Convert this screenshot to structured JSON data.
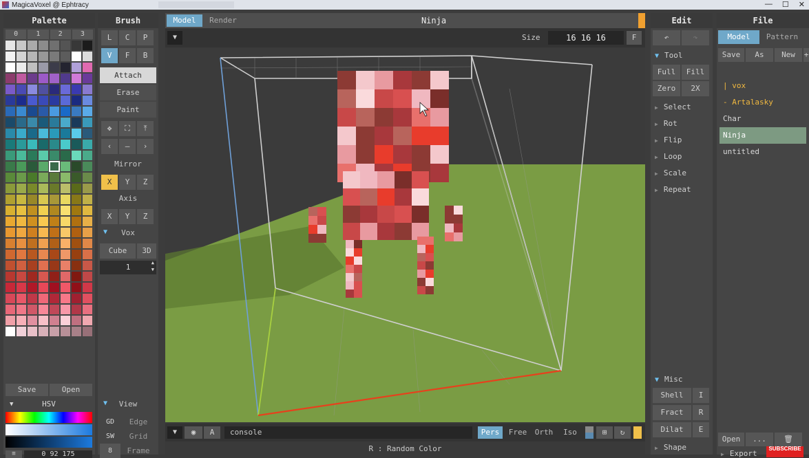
{
  "window": {
    "title": "MagicaVoxel @ Ephtracy",
    "controls": [
      "—",
      "☐",
      "✕"
    ]
  },
  "palette": {
    "title": "Palette",
    "tabs": [
      "0",
      "1",
      "2",
      "3"
    ],
    "save_label": "Save",
    "open_label": "Open",
    "hsv_label": "HSV",
    "hsv_values": "0 92 175",
    "menu_icon": "≡",
    "selected_index": 92,
    "colors": [
      "#e6e6e6",
      "#c8c8c8",
      "#aaaaaa",
      "#8c8c8c",
      "#707070",
      "#545454",
      "#383838",
      "#1c1c1c",
      "#f2f2f2",
      "#d4d4d4",
      "#b6b6b6",
      "#989898",
      "#7a7a7a",
      "#5c5c5c",
      "#ffffff",
      "#dcdcdc",
      "#ffffff",
      "#ececec",
      "#c0c0c0",
      "#9a9aa8",
      "#3c3c4a",
      "#242430",
      "#b0a0d8",
      "#e06ab0",
      "#8c3c6c",
      "#c05aa0",
      "#6c3c8c",
      "#9c5ac8",
      "#a062c8",
      "#503a8c",
      "#d07ad8",
      "#6a3a9a",
      "#7a5ac8",
      "#4a4ab4",
      "#8a8ae0",
      "#5050a0",
      "#2a2a7a",
      "#6a6ad8",
      "#3a3ab0",
      "#8a7ad0",
      "#2a3a9a",
      "#1c2c8c",
      "#4a5ad0",
      "#3a4ab8",
      "#2a3aa0",
      "#5a6ad8",
      "#1a2a80",
      "#6a8ae0",
      "#2a6ab8",
      "#3a8ad0",
      "#1a4a90",
      "#2a5aa8",
      "#4a9ae0",
      "#1a6ac8",
      "#3a7ac0",
      "#5aaae8",
      "#1a4a6a",
      "#2a6a8a",
      "#3a8aaa",
      "#1a5a7a",
      "#2a7a9a",
      "#4aaaca",
      "#1a3a5a",
      "#3a9aba",
      "#2a8aaa",
      "#3aaaca",
      "#1a6a8a",
      "#4abada",
      "#2a9aba",
      "#1a7a9a",
      "#5acaea",
      "#2a5a7a",
      "#1a7a7a",
      "#2a9a9a",
      "#3ababa",
      "#1a6a6a",
      "#2a8a8a",
      "#4acaca",
      "#1a5a5a",
      "#3aaaaa",
      "#3a9a7a",
      "#4aba9a",
      "#2a7a5a",
      "#5acaaa",
      "#3a8a6a",
      "#2a6a4a",
      "#6adaba",
      "#4aaa8a",
      "#3a7a4a",
      "#4a9a5a",
      "#2a5a3a",
      "#5aaa6a",
      "#3a6a4a",
      "#6aba7a",
      "#2a4a2a",
      "#4a8a5a",
      "#5a8a3a",
      "#6a9a4a",
      "#4a7a2a",
      "#7aaa5a",
      "#5a7a3a",
      "#8aba6a",
      "#3a5a2a",
      "#6a8a4a",
      "#8a9a3a",
      "#9aaa4a",
      "#7a8a2a",
      "#aaba5a",
      "#6a7a2a",
      "#babe6a",
      "#5a6a1a",
      "#9a9a4a",
      "#b0a030",
      "#c8b840",
      "#988828",
      "#d8c850",
      "#a89838",
      "#e8d860",
      "#887818",
      "#c0b048",
      "#d8b030",
      "#e8c040",
      "#c09020",
      "#f0d050",
      "#b08820",
      "#f8e070",
      "#a07810",
      "#e0b840",
      "#e8a830",
      "#f0b840",
      "#d09020",
      "#f8c850",
      "#c08018",
      "#f8d868",
      "#b07010",
      "#e8b048",
      "#e89830",
      "#f0a840",
      "#d08020",
      "#f8b850",
      "#c07018",
      "#f8c868",
      "#b06010",
      "#e8a048",
      "#d88030",
      "#e89040",
      "#c07020",
      "#f0a050",
      "#b06018",
      "#f8b068",
      "#a05010",
      "#e08848",
      "#d06830",
      "#e07840",
      "#b85820",
      "#e88850",
      "#a84818",
      "#f09868",
      "#984010",
      "#d87048",
      "#c05030",
      "#d06040",
      "#a84020",
      "#e07050",
      "#983818",
      "#e88068",
      "#883010",
      "#c85848",
      "#b83830",
      "#c84840",
      "#a02820",
      "#d85850",
      "#902018",
      "#e06868",
      "#801810",
      "#c04848",
      "#c82838",
      "#d83848",
      "#b01828",
      "#e84858",
      "#a01020",
      "#f05868",
      "#901018",
      "#d03848",
      "#d84858",
      "#e85868",
      "#c03848",
      "#f06878",
      "#b02838",
      "#f87888",
      "#a02030",
      "#e05060",
      "#e86878",
      "#f07888",
      "#d05868",
      "#f88898",
      "#c04858",
      "#f898a8",
      "#b03848",
      "#e87080",
      "#f0a0a8",
      "#f8b0b8",
      "#e090a0",
      "#f8c0c8",
      "#d08090",
      "#fcd0d8",
      "#c07080",
      "#f0a8b0",
      "#ffffff",
      "#f0d0d8",
      "#e8c0c8",
      "#d8b0b8",
      "#c8a0a8",
      "#b89098",
      "#a88088",
      "#987078"
    ]
  },
  "brush": {
    "title": "Brush",
    "row1": [
      "L",
      "C",
      "P"
    ],
    "row2": [
      "V",
      "F",
      "B"
    ],
    "modes": [
      "Attach",
      "Erase",
      "Paint"
    ],
    "tool_icons": [
      "move-icon",
      "select-box-icon",
      "pick-icon"
    ],
    "tool_glyphs": [
      "✥",
      "⛶",
      "⤒"
    ],
    "nav": [
      "‹",
      "—",
      "›"
    ],
    "mirror_label": "Mirror",
    "mirror": [
      "X",
      "Y",
      "Z"
    ],
    "axis_label": "Axis",
    "axis": [
      "X",
      "Y",
      "Z"
    ],
    "vox_label": "Vox",
    "vox_opts": [
      "Cube",
      "3D"
    ],
    "vox_value": "1",
    "view_label": "View",
    "view_rows": [
      {
        "key": "GD",
        "label": "Edge"
      },
      {
        "key": "SW",
        "label": "Grid"
      },
      {
        "key": "8",
        "label": "Frame"
      }
    ]
  },
  "viewport": {
    "tabs": [
      "Model",
      "Render"
    ],
    "title": "Ninja",
    "size_label": "Size",
    "size_value": "16 16 16",
    "f_label": "F",
    "console_placeholder": "console",
    "a_label": "A",
    "modes": [
      "Pers",
      "Free",
      "Orth",
      "Iso"
    ],
    "status": "R : Random Color",
    "floor_color": "#7a9c44",
    "bg_color": "#3b3b3b"
  },
  "edit": {
    "title": "Edit",
    "tool_label": "Tool",
    "tools": [
      [
        "Full",
        "Fill"
      ],
      [
        "Zero",
        "2X"
      ]
    ],
    "items": [
      "Select",
      "Rot",
      "Flip",
      "Loop",
      "Scale",
      "Repeat"
    ],
    "misc_label": "Misc",
    "misc": [
      [
        "Shell",
        "I"
      ],
      [
        "Fract",
        "R"
      ],
      [
        "Dilat",
        "E"
      ]
    ],
    "shape_label": "Shape"
  },
  "file": {
    "title": "File",
    "tabs": [
      "Model",
      "Pattern"
    ],
    "actions": [
      "Save",
      "As",
      "New",
      "+"
    ],
    "items": [
      "| vox",
      "- Artalasky",
      "Char",
      "Ninja",
      "untitled"
    ],
    "selected": "Ninja",
    "bottom": [
      "Open",
      "...",
      "🗑"
    ],
    "export_label": "Export",
    "subscribe": "SUBSCRIBE"
  }
}
